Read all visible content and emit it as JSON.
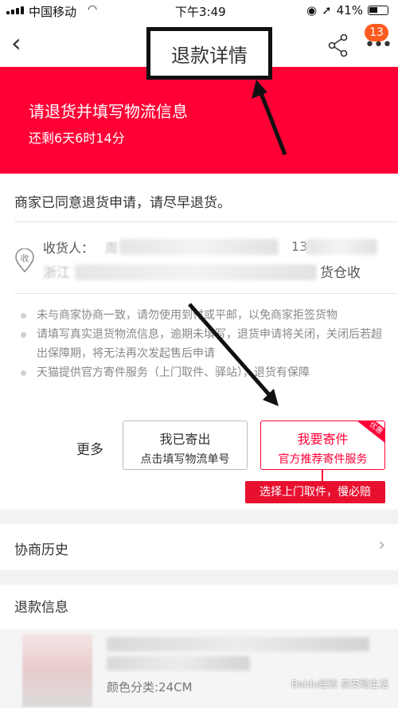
{
  "status_bar": {
    "carrier": "中国移动",
    "time": "下午3:49",
    "battery": "41%"
  },
  "nav": {
    "title": "退款详情",
    "back_icon": "chevron-left-icon",
    "share_icon": "share-icon",
    "more_icon": "ellipsis-icon",
    "badge": "13"
  },
  "banner": {
    "title": "请退货并填写物流信息",
    "countdown": "还剩6天6时14分"
  },
  "notice": "商家已同意退货申请，请尽早退货。",
  "address": {
    "icon_text": "收",
    "recipient_label": "收货人：",
    "recipient_name_partial": "周",
    "phone_partial": "13",
    "address_tail": "货仓收",
    "address_head": "浙江"
  },
  "tips": [
    "未与商家协商一致，请勿使用到付或平邮，以免商家拒签货物",
    "请填写真实退货物流信息，逾期未填写，退货申请将关闭，关闭后若超出保障期，将无法再次发起售后申请",
    "天猫提供官方寄件服务（上门取件、驿站），退货有保障"
  ],
  "actions": {
    "more_label": "更多",
    "sent_title": "我已寄出",
    "sent_sub": "点击填写物流单号",
    "pickup_title": "我要寄件",
    "pickup_sub": "官方推荐寄件服务",
    "pickup_corner": "优惠",
    "pickup_tooltip": "选择上门取件，慢必赔"
  },
  "history": {
    "label": "协商历史"
  },
  "refund_info": {
    "label": "退款信息",
    "spec": "颜色分类:24CM"
  },
  "watermark": "Baidu经验 高安聪生活",
  "colors": {
    "brand_red": "#ff0036",
    "badge_orange": "#ff5a1f"
  }
}
